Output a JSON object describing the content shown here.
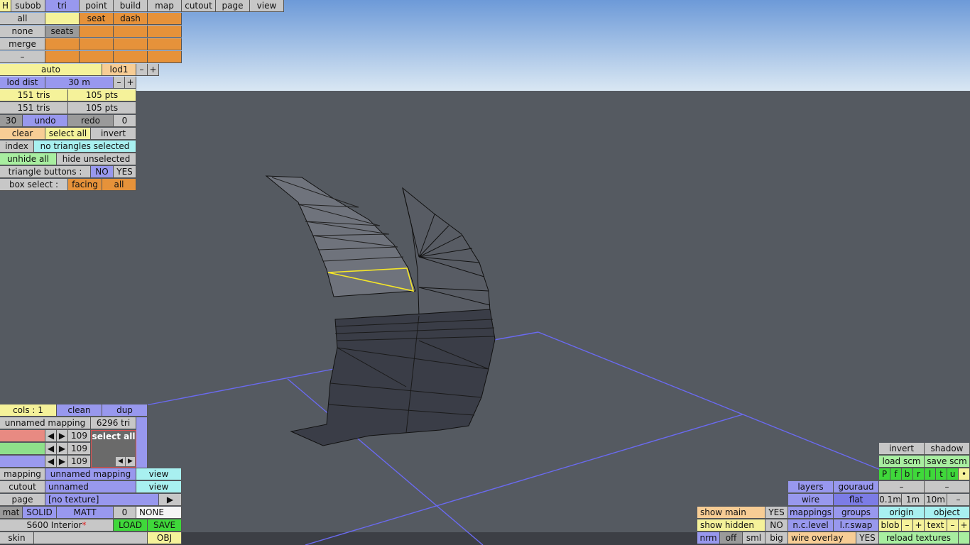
{
  "top_menu": {
    "h": "H",
    "tabs": [
      "subob",
      "tri",
      "point",
      "build",
      "map",
      "cutout",
      "page",
      "view"
    ],
    "row_all": "all",
    "row_none": "none",
    "row_merge": "merge",
    "row_minus": "–",
    "seat": "seat",
    "dash": "dash",
    "seats": "seats"
  },
  "lod": {
    "auto": "auto",
    "lod1": "lod1",
    "minus": "–",
    "plus": "+",
    "dist_label": "lod dist",
    "dist_value": "30 m"
  },
  "stats": {
    "tris1": "151 tris",
    "pts1": "105 pts",
    "tris2": "151 tris",
    "pts2": "105 pts"
  },
  "history": {
    "count": "30",
    "undo": "undo",
    "redo": "redo",
    "redo_count": "0"
  },
  "selection": {
    "clear": "clear",
    "select_all": "select all",
    "invert": "invert",
    "index": "index",
    "status": "no triangles selected",
    "unhide_all": "unhide all",
    "hide_unselected": "hide unselected",
    "tri_buttons_label": "triangle buttons :",
    "no": "NO",
    "yes": "YES",
    "box_select_label": "box select :",
    "facing": "facing",
    "all": "all"
  },
  "mapping_panel": {
    "cols": "cols : 1",
    "clean": "clean",
    "dup": "dup",
    "unnamed_mapping": "unnamed mapping",
    "tri_count": "6296 tri",
    "slider_values": [
      "109",
      "109",
      "109"
    ],
    "select_all": "select all",
    "mapping_label": "mapping",
    "mapping_value": "unnamed mapping",
    "view": "view",
    "cutout_label": "cutout",
    "cutout_value": "unnamed",
    "page_label": "page",
    "page_value": "[no texture]",
    "play": "▶",
    "mat": "mat",
    "solid": "SOLID",
    "matt": "MATT",
    "zero": "0",
    "none": "NONE",
    "file_name": "S600 Interior",
    "modified": "*",
    "load": "LOAD",
    "save": "SAVE",
    "skin": "skin",
    "obj": "OBJ"
  },
  "view_panel": {
    "invert": "invert",
    "shadow": "shadow",
    "load_scm": "load scm",
    "save_scm": "save scm",
    "axes": [
      "P",
      "f",
      "b",
      "r",
      "l",
      "t",
      "u",
      "•"
    ],
    "layers": "layers",
    "gouraud": "gouraud",
    "minus": "–",
    "wire": "wire",
    "flat": "flat",
    "d01": "0.1m",
    "d1": "1m",
    "d10": "10m",
    "show_main": "show main",
    "show_main_val": "YES",
    "mappings": "mappings",
    "groups": "groups",
    "origin": "origin",
    "object": "object",
    "show_hidden": "show hidden",
    "show_hidden_val": "NO",
    "nc_level": "n.c.level",
    "lr_swap": "l.r.swap",
    "blob": "blob",
    "plus": "+",
    "text": "text",
    "nrm": "nrm",
    "off": "off",
    "sml": "sml",
    "big": "big",
    "wire_overlay": "wire overlay",
    "wire_overlay_val": "YES",
    "reload_textures": "reload textures"
  },
  "colors": {
    "sky_top": "#6d9ad8",
    "sky_bottom": "#d9e7f3",
    "ground": "#555a61",
    "grid_line": "#6a6af0",
    "selected_edge": "#f5e628"
  }
}
